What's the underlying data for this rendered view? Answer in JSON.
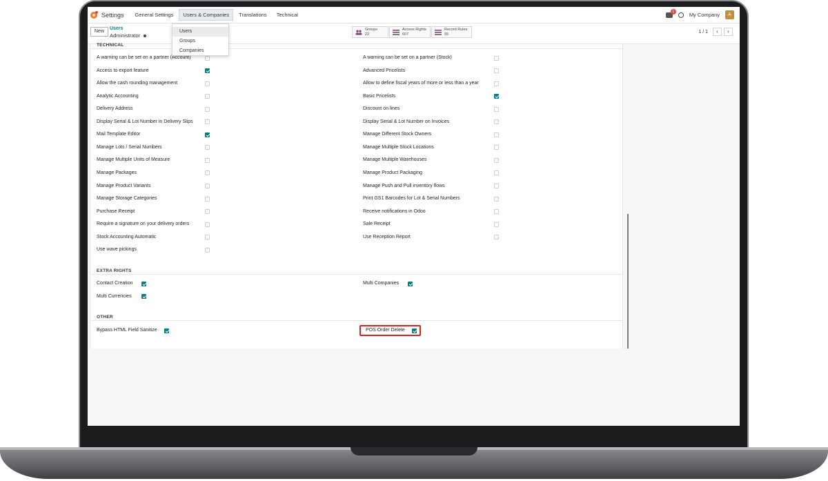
{
  "app": {
    "name": "Settings",
    "menu": [
      "General Settings",
      "Users & Companies",
      "Translations",
      "Technical"
    ],
    "active_menu_index": 1
  },
  "topbar": {
    "chat_badge": "1",
    "company": "My Company",
    "avatar_letter": "A"
  },
  "dropdown": {
    "items": [
      "Users",
      "Groups",
      "Companies"
    ],
    "selected_index": 0
  },
  "control": {
    "new_label": "New",
    "breadcrumb_parent": "Users",
    "breadcrumb_current": "Administrator",
    "stats": [
      {
        "label": "Groups",
        "value": "22"
      },
      {
        "label": "Access Rights",
        "value": "607"
      },
      {
        "label": "Record Rules",
        "value": "55"
      }
    ],
    "pager_value": "1 / 1",
    "prev_glyph": "‹",
    "next_glyph": "›"
  },
  "sections": {
    "technical": {
      "title": "TECHNICAL",
      "left": [
        {
          "label": "A warning can be set on a partner (Account)",
          "checked": false
        },
        {
          "label": "Access to export feature",
          "checked": true
        },
        {
          "label": "Allow the cash rounding management",
          "checked": false
        },
        {
          "label": "Analytic Accounting",
          "checked": false
        },
        {
          "label": "Delivery Address",
          "checked": false
        },
        {
          "label": "Display Serial & Lot Number in Delivery Slips",
          "checked": false
        },
        {
          "label": "Mail Template Editor",
          "checked": true
        },
        {
          "label": "Manage Lots / Serial Numbers",
          "checked": false
        },
        {
          "label": "Manage Multiple Units of Measure",
          "checked": false
        },
        {
          "label": "Manage Packages",
          "checked": false
        },
        {
          "label": "Manage Product Variants",
          "checked": false
        },
        {
          "label": "Manage Storage Categories",
          "checked": false
        },
        {
          "label": "Purchase Receipt",
          "checked": false
        },
        {
          "label": "Require a signature on your delivery orders",
          "checked": false
        },
        {
          "label": "Stock Accounting Automatic",
          "checked": false
        },
        {
          "label": "Use wave pickings",
          "checked": false
        }
      ],
      "right": [
        {
          "label": "A warning can be set on a partner (Stock)",
          "checked": false
        },
        {
          "label": "Advanced Pricelists",
          "checked": false
        },
        {
          "label": "Allow to define fiscal years of more or less than a year",
          "checked": false
        },
        {
          "label": "Basic Pricelists",
          "checked": true
        },
        {
          "label": "Discount on lines",
          "checked": false
        },
        {
          "label": "Display Serial & Lot Number on Invoices",
          "checked": false
        },
        {
          "label": "Manage Different Stock Owners",
          "checked": false
        },
        {
          "label": "Manage Multiple Stock Locations",
          "checked": false
        },
        {
          "label": "Manage Multiple Warehouses",
          "checked": false
        },
        {
          "label": "Manage Product Packaging",
          "checked": false
        },
        {
          "label": "Manage Push and Pull inventory flows",
          "checked": false
        },
        {
          "label": "Print GS1 Barcodes for Lot & Serial Numbers",
          "checked": false
        },
        {
          "label": "Receive notifications in Odoo",
          "checked": false
        },
        {
          "label": "Sale Receipt",
          "checked": false
        },
        {
          "label": "Use Reception Report",
          "checked": false
        }
      ]
    },
    "extra_rights": {
      "title": "EXTRA RIGHTS",
      "left": [
        {
          "label": "Contact Creation",
          "checked": true
        },
        {
          "label": "Multi Currencies",
          "checked": true
        }
      ],
      "right": [
        {
          "label": "Multi Companies",
          "checked": true
        }
      ]
    },
    "other": {
      "title": "OTHER",
      "left": [
        {
          "label": "Bypass HTML Field Sanitize",
          "checked": true
        }
      ],
      "right": [
        {
          "label": "POS Order Delete",
          "checked": true
        }
      ]
    }
  },
  "colors": {
    "accent": "#017e84",
    "highlight": "#d5202a",
    "brand": "#f07b2c"
  }
}
